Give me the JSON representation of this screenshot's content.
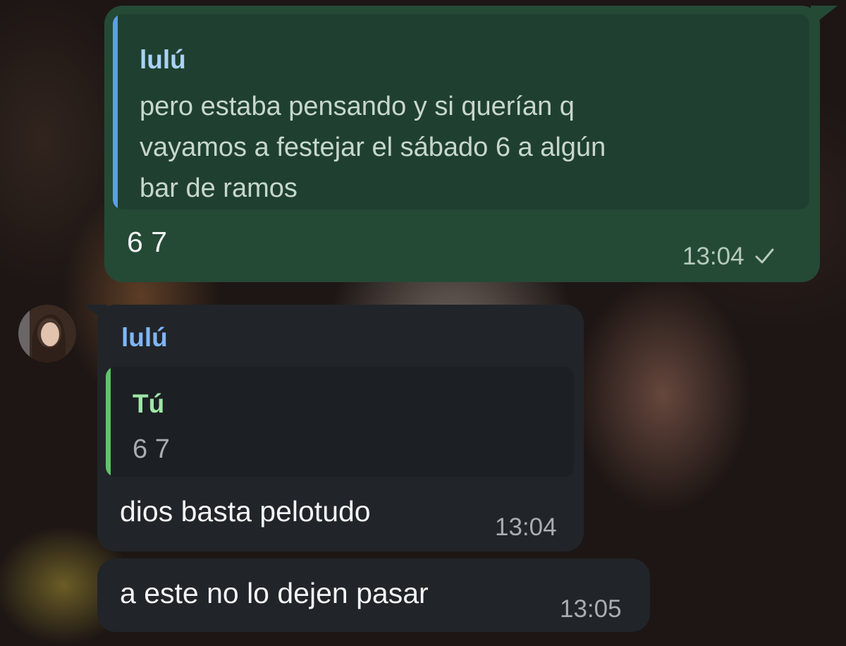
{
  "messages": {
    "outgoing": {
      "reply": {
        "author": "lulú",
        "lines": [
          "pero estaba pensando y si querían q",
          "vayamos a festejar el sábado 6 a algún",
          "bar de ramos"
        ]
      },
      "text": "6 7",
      "time": "13:04",
      "status_icon": "single-check-icon"
    },
    "incoming": {
      "sender": "lulú",
      "reply": {
        "author": "Tú",
        "text": "6 7"
      },
      "text": "dios basta pelotudo",
      "time": "13:04"
    },
    "incoming_2": {
      "text": "a este no lo dejen pasar",
      "time": "13:05"
    }
  },
  "colors": {
    "outgoing_bubble": "#244a36",
    "outgoing_reply_bg": "#1f4030",
    "outgoing_reply_bar": "#5aa0e8",
    "outgoing_reply_name": "#a9d2f7",
    "outgoing_reply_text": "#c8d6cd",
    "outgoing_time": "#b6c9bc",
    "incoming_bubble": "#212529",
    "incoming_reply_bg": "#1c1f23",
    "incoming_reply_bar": "#5fc46c",
    "incoming_reply_name": "#9ee6a9",
    "incoming_reply_text": "#a9adb2",
    "sender_name": "#7fb6f5",
    "incoming_time": "#a9adb2"
  }
}
